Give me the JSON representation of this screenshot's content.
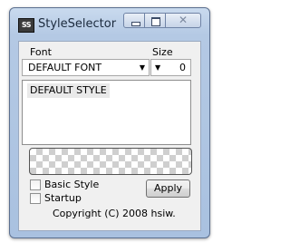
{
  "window": {
    "title": "StyleSelector",
    "app_icon_text": "SS",
    "close_glyph": "✕"
  },
  "font": {
    "label": "Font",
    "selected": "DEFAULT FONT",
    "arrow": "▼"
  },
  "size": {
    "label": "Size",
    "selected": "0",
    "arrow": "▼"
  },
  "styles": {
    "items": [
      "DEFAULT STYLE"
    ]
  },
  "options": {
    "basic_style_label": "Basic Style",
    "basic_style_checked": false,
    "startup_label": "Startup",
    "startup_checked": false
  },
  "apply_label": "Apply",
  "copyright": "Copyright (C) 2008 hsiw."
}
